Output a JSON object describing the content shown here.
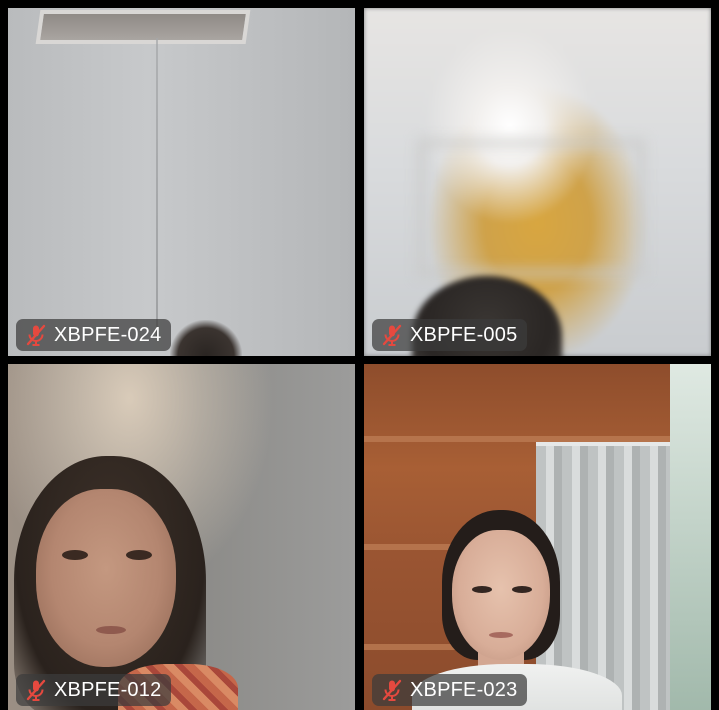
{
  "participants": [
    {
      "name": "XBPFE-024",
      "muted": true,
      "mute_icon": "mic-off-icon"
    },
    {
      "name": "XBPFE-005",
      "muted": true,
      "mute_icon": "mic-off-icon"
    },
    {
      "name": "XBPFE-012",
      "muted": true,
      "mute_icon": "mic-off-icon"
    },
    {
      "name": "XBPFE-023",
      "muted": true,
      "mute_icon": "mic-off-icon"
    }
  ],
  "colors": {
    "mute_icon": "#e5493f",
    "badge_bg": "#3c3c3c",
    "grid_gap": "#000000"
  }
}
